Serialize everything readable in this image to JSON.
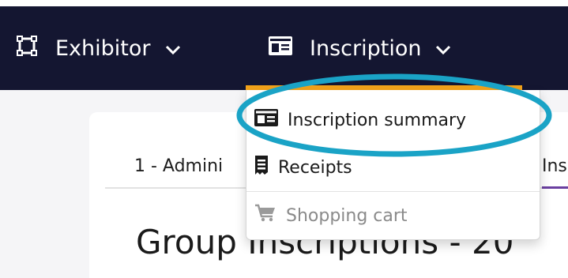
{
  "nav": {
    "exhibitor_label": "Exhibitor",
    "inscription_label": "Inscription"
  },
  "dropdown": {
    "items": [
      {
        "label": "Inscription summary",
        "icon": "id-card-icon"
      },
      {
        "label": "Receipts",
        "icon": "receipt-icon"
      },
      {
        "label": "Shopping cart",
        "icon": "shopping-cart-icon",
        "disabled": true
      }
    ]
  },
  "tabs": {
    "admin_label": "1 - Admini",
    "next_label": "Inscr"
  },
  "page": {
    "title": "Group Inscriptions - 20"
  },
  "colors": {
    "navbar": "#141631",
    "active_accent": "#f3a31a",
    "tab_accent": "#6a3fa0",
    "highlight_ring": "#1aa3c6"
  }
}
